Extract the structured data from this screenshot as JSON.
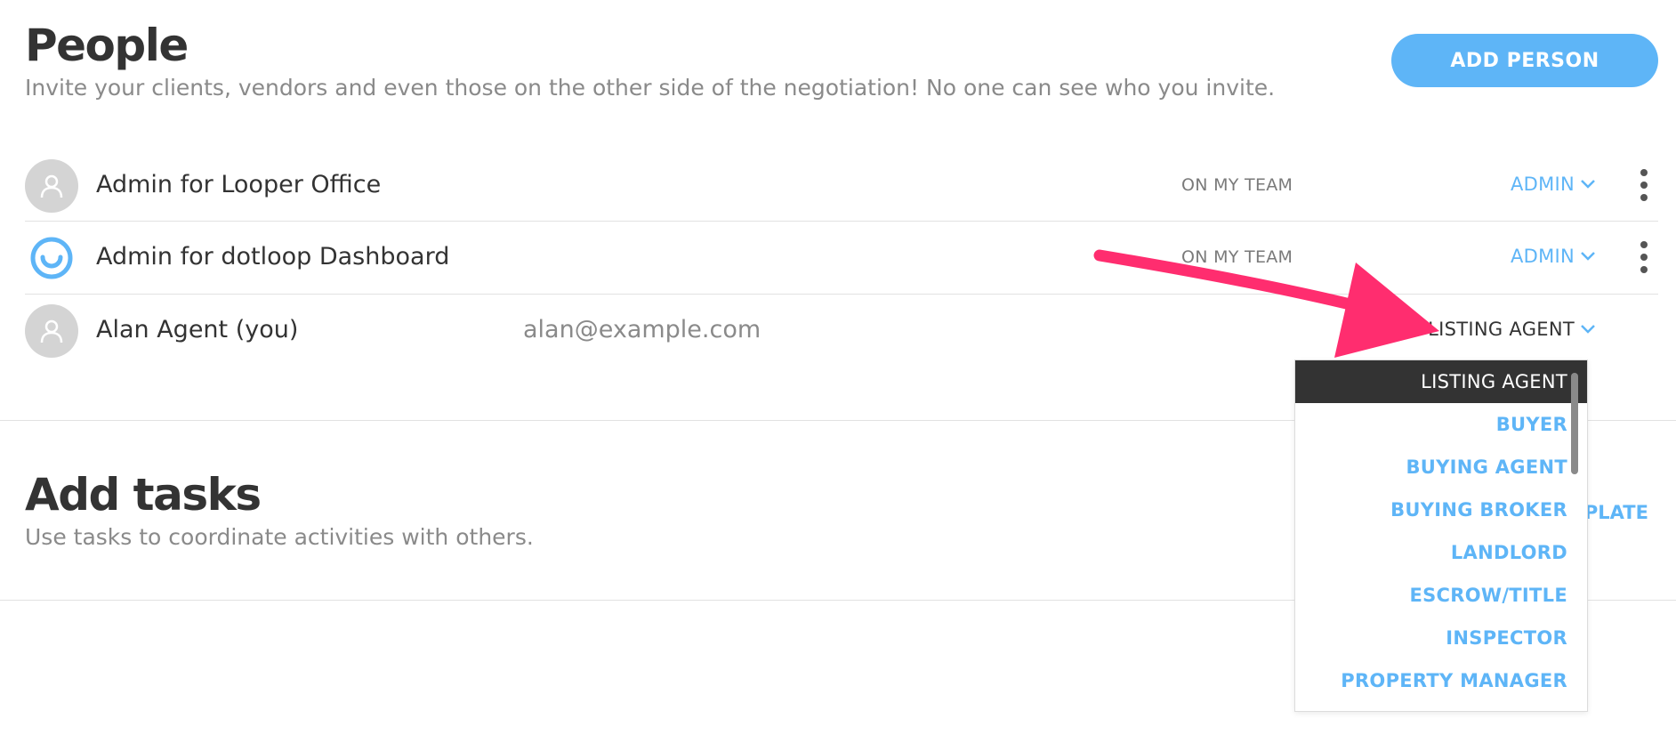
{
  "people": {
    "title": "People",
    "subtitle": "Invite your clients, vendors and even those on the other side of the negotiation! No one can see who you invite.",
    "add_button": "ADD PERSON",
    "rows": [
      {
        "name": "Admin for Looper Office",
        "email": "",
        "team": "ON MY TEAM",
        "role": "ADMIN",
        "avatar": "user-placeholder-icon"
      },
      {
        "name": "Admin for dotloop Dashboard",
        "email": "",
        "team": "ON MY TEAM",
        "role": "ADMIN",
        "avatar": "dotloop-logo-icon"
      },
      {
        "name": "Alan Agent (you)",
        "email": "alan@example.com",
        "team": "",
        "role": "LISTING AGENT",
        "avatar": "user-placeholder-icon"
      }
    ]
  },
  "role_dropdown": {
    "selected": "LISTING AGENT",
    "options": [
      "LISTING AGENT",
      "BUYER",
      "BUYING AGENT",
      "BUYING BROKER",
      "LANDLORD",
      "ESCROW/TITLE",
      "INSPECTOR",
      "PROPERTY MANAGER"
    ]
  },
  "tasks": {
    "title": "Add tasks",
    "subtitle": "Use tasks to coordinate activities with others.",
    "template_link": "MPLATE"
  },
  "colors": {
    "accent": "#5eb5f7",
    "annotation_arrow": "#ff2d6f",
    "selected_option_bg": "#333333",
    "avatar_placeholder": "#d4d4d4"
  }
}
